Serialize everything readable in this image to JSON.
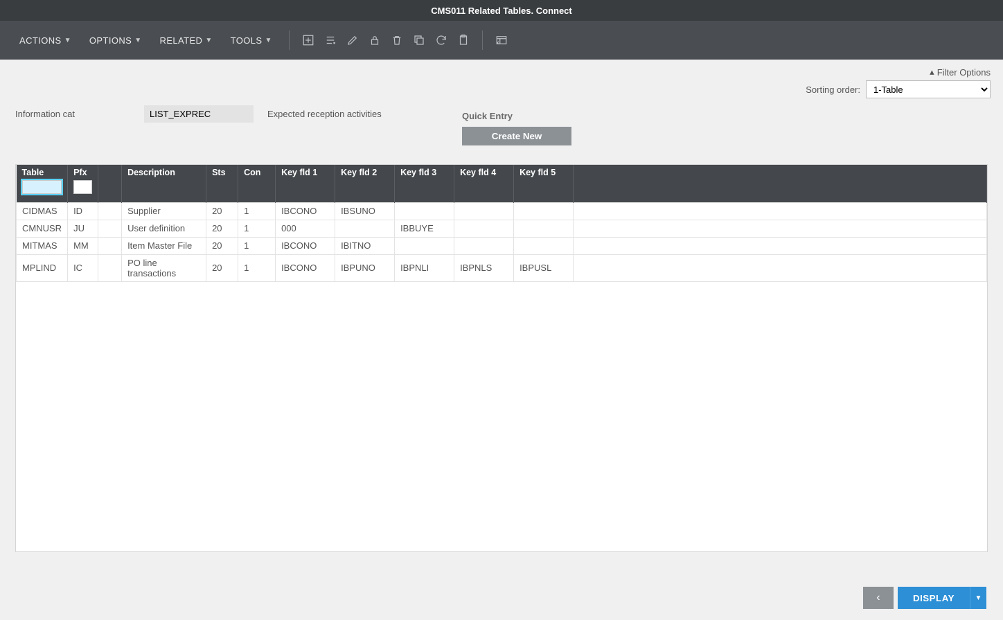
{
  "title": "CMS011 Related Tables. Connect",
  "menu": {
    "actions": "ACTIONS",
    "options": "OPTIONS",
    "related": "RELATED",
    "tools": "TOOLS"
  },
  "filterbar": {
    "filterOptions": "Filter Options",
    "sortLabel": "Sorting order:",
    "sortValue": "1-Table"
  },
  "meta": {
    "infoCatLabel": "Information cat",
    "infoCatValue": "LIST_EXPREC",
    "infoCatDesc": "Expected reception activities"
  },
  "quick": {
    "label": "Quick Entry",
    "createNew": "Create New"
  },
  "table": {
    "headers": {
      "table": "Table",
      "pfx": "Pfx",
      "desc": "Description",
      "sts": "Sts",
      "con": "Con",
      "kf1": "Key fld 1",
      "kf2": "Key fld 2",
      "kf3": "Key fld 3",
      "kf4": "Key fld 4",
      "kf5": "Key fld 5"
    },
    "rows": [
      {
        "table": "CIDMAS",
        "pfx": "ID",
        "desc": "Supplier",
        "sts": "20",
        "con": "1",
        "kf1": "IBCONO",
        "kf2": "IBSUNO",
        "kf3": "",
        "kf4": "",
        "kf5": ""
      },
      {
        "table": "CMNUSR",
        "pfx": "JU",
        "desc": "User definition",
        "sts": "20",
        "con": "1",
        "kf1": "000",
        "kf2": "",
        "kf3": "IBBUYE",
        "kf4": "",
        "kf5": ""
      },
      {
        "table": "MITMAS",
        "pfx": "MM",
        "desc": "Item Master File",
        "sts": "20",
        "con": "1",
        "kf1": "IBCONO",
        "kf2": "IBITNO",
        "kf3": "",
        "kf4": "",
        "kf5": ""
      },
      {
        "table": "MPLIND",
        "pfx": "IC",
        "desc": "PO line transactions",
        "sts": "20",
        "con": "1",
        "kf1": "IBCONO",
        "kf2": "IBPUNO",
        "kf3": "IBPNLI",
        "kf4": "IBPNLS",
        "kf5": "IBPUSL"
      }
    ]
  },
  "footer": {
    "display": "DISPLAY"
  }
}
